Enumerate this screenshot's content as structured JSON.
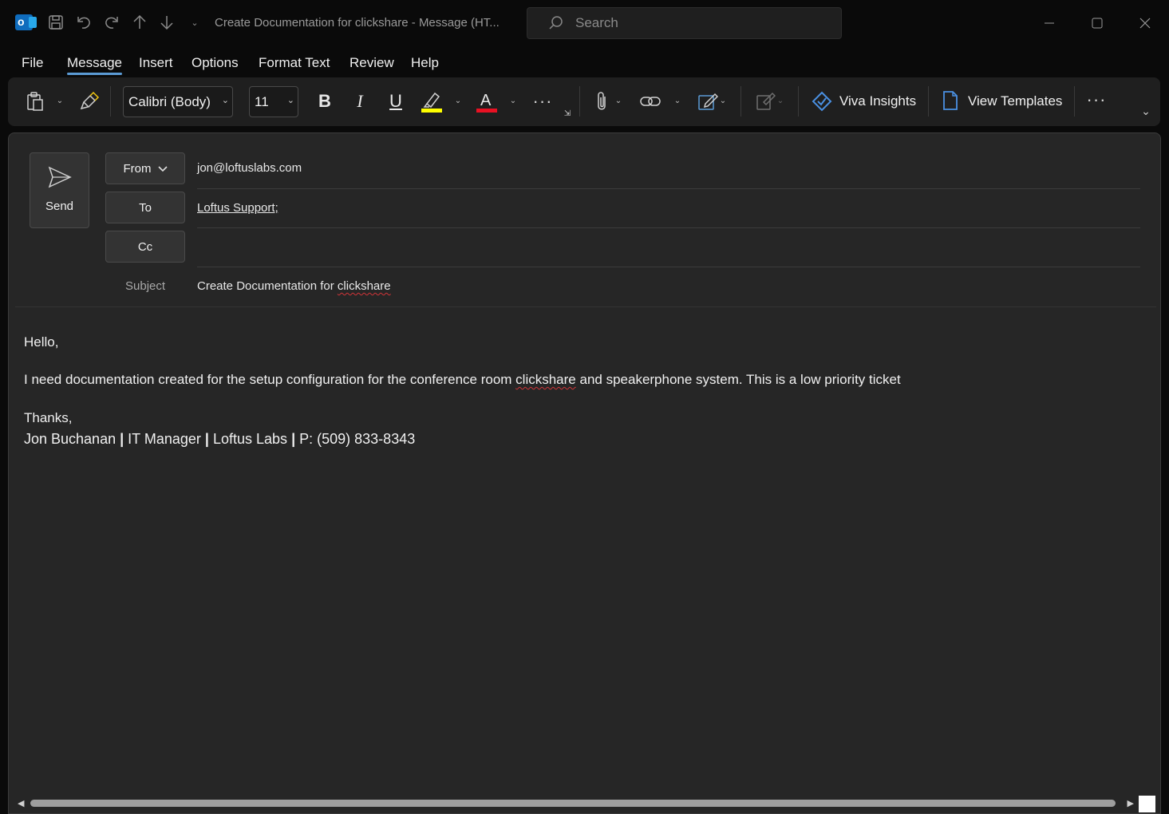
{
  "window": {
    "title": "Create Documentation for clickshare  -  Message (HT...",
    "search_placeholder": "Search"
  },
  "menu": {
    "tabs": [
      "File",
      "Message",
      "Insert",
      "Options",
      "Format Text",
      "Review",
      "Help"
    ],
    "active_tab": "Message"
  },
  "ribbon": {
    "font_name": "Calibri (Body)",
    "font_size": "11",
    "bold_glyph": "B",
    "italic_glyph": "I",
    "underline_glyph": "U",
    "font_color_glyph": "A",
    "highlight_color": "#ffff00",
    "font_color": "#e81123",
    "viva_insights_label": "Viva Insights",
    "view_templates_label": "View Templates"
  },
  "compose": {
    "send_label": "Send",
    "from_label": "From",
    "from_value": "jon@loftuslabs.com",
    "to_label": "To",
    "to_value": "Loftus Support;",
    "cc_label": "Cc",
    "cc_value": "",
    "subject_label": "Subject",
    "subject_prefix": "Create Documentation for ",
    "subject_misspelled": "clickshare"
  },
  "body": {
    "greeting": "Hello,",
    "line1_before": "I need documentation created for the setup configuration for the conference room ",
    "line1_misspelled": "clickshare",
    "line1_after": " and speakerphone system. This is a low priority ticket",
    "closing": "Thanks,",
    "signature": {
      "name": "Jon Buchanan",
      "separator": "|",
      "role": "IT Manager",
      "company": "Loftus Labs",
      "phone": "P: (509) 833-8343"
    }
  }
}
